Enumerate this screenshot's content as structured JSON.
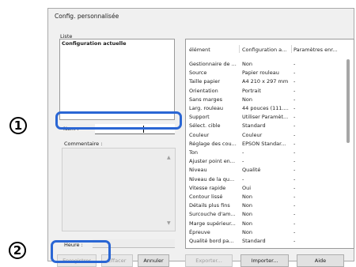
{
  "dialog": {
    "title": "Config. personnalisée",
    "liste_label": "Liste",
    "list_items": [
      "Configuration actuelle"
    ],
    "nom_label": "Nom :",
    "nom_value": "",
    "comment_label": "Commentaire :",
    "heure_label": "Heure :"
  },
  "table": {
    "headers": [
      "élément",
      "Configuration a...",
      "Paramètres enr..."
    ],
    "rows": [
      [
        "Gestionnaire de ...",
        "Non",
        "-"
      ],
      [
        "Source",
        "Papier rouleau",
        "-"
      ],
      [
        "Taille papier",
        "A4 210 x 297 mm",
        "-"
      ],
      [
        "Orientation",
        "Portrait",
        "-"
      ],
      [
        "Sans marges",
        "Non",
        "-"
      ],
      [
        "Larg. rouleau",
        "44 pouces (111....",
        "-"
      ],
      [
        "Support",
        "Utiliser Paramèt...",
        "-"
      ],
      [
        "Sélect. cible",
        "Standard",
        "-"
      ],
      [
        "Couleur",
        "Couleur",
        "-"
      ],
      [
        "Réglage des cou...",
        "EPSON Standar...",
        "-"
      ],
      [
        "Ton",
        "-",
        "-"
      ],
      [
        "Ajuster point en...",
        "-",
        "-"
      ],
      [
        "Niveau",
        "Qualité",
        "-"
      ],
      [
        "Niveau de la qu...",
        "-",
        "-"
      ],
      [
        "Vitesse rapide",
        "Oui",
        "-"
      ],
      [
        "Contour lissé",
        "Non",
        "-"
      ],
      [
        "Détails plus fins",
        "Non",
        "-"
      ],
      [
        "Surcouche d'am...",
        "Non",
        "-"
      ],
      [
        "Marge supérieur...",
        "Non",
        "-"
      ],
      [
        "Épreuve",
        "Non",
        "-"
      ],
      [
        "Qualité bord pa...",
        "Standard",
        "-"
      ]
    ]
  },
  "buttons": {
    "enregistrer": "Enregistrer",
    "effacer": "Effacer",
    "annuler": "Annuler",
    "exporter": "Exporter...",
    "importer": "Importer...",
    "aide": "Aide"
  },
  "markers": {
    "one": "1",
    "two": "2"
  },
  "colors": {
    "highlight": "#2a66d4",
    "dialog_bg": "#f0f0f0"
  }
}
